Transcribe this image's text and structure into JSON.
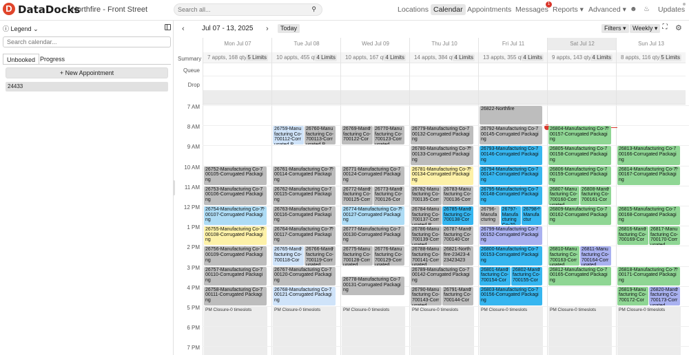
{
  "app": {
    "brand": "DataDocks",
    "logo_letter": "D",
    "location": "Northfire - Front Street"
  },
  "search": {
    "placeholder": "Search all..."
  },
  "nav": {
    "items": [
      "Locations",
      "Calendar",
      "Appointments",
      "Messages",
      "Reports ▾",
      "Advanced ▾"
    ],
    "active": "Calendar",
    "messages_badge": "1",
    "updates": "Updates"
  },
  "sidebar": {
    "legend": "Legend",
    "search_placeholder": "Search calendar...",
    "tabs": [
      "Unbooked",
      "Progress"
    ],
    "new_button": "+ New Appointment",
    "unbooked_items": [
      "24433"
    ]
  },
  "calendar": {
    "range": "Jul 07 - 13, 2025",
    "today_button": "Today",
    "filters": "Filters ▾",
    "view": "Weekly ▾",
    "gutter_labels": {
      "summary": "Summary",
      "queue": "Queue",
      "drop": "Drop"
    },
    "hours": [
      "7 AM",
      "8 AM",
      "9 AM",
      "10 AM",
      "11 AM",
      "12 PM",
      "1 PM",
      "2 PM",
      "3 PM",
      "4 PM",
      "5 PM",
      "6 PM",
      "7 PM"
    ],
    "closure_label": "PM Closure-0 timeslots",
    "limits_label": "Limits",
    "days": [
      {
        "label": "Mon Jul 07",
        "summary": "7 appts, 168 qty",
        "limits": "5"
      },
      {
        "label": "Tue Jul 08",
        "summary": "10 appts, 455 qty",
        "limits": "4"
      },
      {
        "label": "Wed Jul 09",
        "summary": "10 appts, 167 qty",
        "limits": "4"
      },
      {
        "label": "Thu Jul 10",
        "summary": "14 appts, 384 qty",
        "limits": "4"
      },
      {
        "label": "Fri Jul 11",
        "summary": "13 appts, 355 qty",
        "limits": "4"
      },
      {
        "label": "Sat Jul 12",
        "summary": "9 appts, 143 qty",
        "limits": "4",
        "today": true
      },
      {
        "label": "Sun Jul 13",
        "summary": "8 appts, 116 qty",
        "limits": "5"
      }
    ],
    "colors": {
      "gray": "#bdbdbd",
      "green": "#8fd694",
      "yellow": "#fdf1a8",
      "blue": "#aedcf5",
      "cyan": "#36b6f0",
      "purple": "#a9b1f0",
      "lightblue": "#cfe3f9"
    },
    "appointments": [
      {
        "day": 0,
        "start": "10:00",
        "end": "11:00",
        "lane": 0,
        "lanes": 1,
        "color": "gray",
        "text": "26752-Manufacturing Co-700105-Corrugated Packaging"
      },
      {
        "day": 0,
        "start": "11:00",
        "end": "12:00",
        "lane": 0,
        "lanes": 1,
        "color": "gray",
        "text": "26753-Manufacturing Co-700106-Corrugated Packaging"
      },
      {
        "day": 0,
        "start": "12:00",
        "end": "13:00",
        "lane": 0,
        "lanes": 1,
        "color": "blue",
        "text": "26754-Manufacturing Co-700107-Corrugated Packaging",
        "arrow": true
      },
      {
        "day": 0,
        "start": "13:00",
        "end": "14:00",
        "lane": 0,
        "lanes": 1,
        "color": "yellow",
        "text": "26755-Manufacturing Co-700108-Corrugated Packaging",
        "arrow": true
      },
      {
        "day": 0,
        "start": "14:00",
        "end": "15:00",
        "lane": 0,
        "lanes": 1,
        "color": "gray",
        "text": "26756-Manufacturing Co-700109-Corrugated Packaging"
      },
      {
        "day": 0,
        "start": "15:00",
        "end": "16:00",
        "lane": 0,
        "lanes": 1,
        "color": "gray",
        "text": "26757-Manufacturing Co-700110-Corrugated Packaging"
      },
      {
        "day": 0,
        "start": "16:00",
        "end": "17:00",
        "lane": 0,
        "lanes": 1,
        "color": "gray",
        "text": "26758-Manufacturing Co-700111-Corrugated Packaging"
      },
      {
        "day": 1,
        "start": "08:00",
        "end": "09:00",
        "lane": 0,
        "lanes": 2,
        "color": "lightblue",
        "text": "26759-Manufacturing Co-700112-Corrugated P"
      },
      {
        "day": 1,
        "start": "08:00",
        "end": "09:00",
        "lane": 1,
        "lanes": 2,
        "color": "gray",
        "text": "26760-Manufacturing Co-700113-Corrugated P"
      },
      {
        "day": 1,
        "start": "10:00",
        "end": "11:00",
        "lane": 0,
        "lanes": 1,
        "color": "gray",
        "text": "26761-Manufacturing Co-700114-Corrugated Packaging",
        "arrow": true
      },
      {
        "day": 1,
        "start": "11:00",
        "end": "12:00",
        "lane": 0,
        "lanes": 1,
        "color": "gray",
        "text": "26762-Manufacturing Co-700115-Corrugated Packaging"
      },
      {
        "day": 1,
        "start": "12:00",
        "end": "13:00",
        "lane": 0,
        "lanes": 1,
        "color": "gray",
        "text": "26763-Manufacturing Co-700116-Corrugated Packaging"
      },
      {
        "day": 1,
        "start": "13:00",
        "end": "14:00",
        "lane": 0,
        "lanes": 1,
        "color": "gray",
        "text": "26764-Manufacturing Co-700117-Corrugated Packaging",
        "arrow": true
      },
      {
        "day": 1,
        "start": "14:00",
        "end": "15:00",
        "lane": 0,
        "lanes": 2,
        "color": "lightblue",
        "text": "26765-Manufacturing Co-700118-Cor",
        "arrow": true
      },
      {
        "day": 1,
        "start": "14:00",
        "end": "15:00",
        "lane": 1,
        "lanes": 2,
        "color": "gray",
        "text": "26766-Manufacturing Co-700119-Corrugated",
        "arrow": true
      },
      {
        "day": 1,
        "start": "15:00",
        "end": "16:00",
        "lane": 0,
        "lanes": 1,
        "color": "gray",
        "text": "26767-Manufacturing Co-700120-Corrugated Packaging"
      },
      {
        "day": 1,
        "start": "16:00",
        "end": "17:00",
        "lane": 0,
        "lanes": 1,
        "color": "lightblue",
        "text": "26768-Manufacturing Co-700121-Corrugated Packaging"
      },
      {
        "day": 2,
        "start": "08:00",
        "end": "09:00",
        "lane": 0,
        "lanes": 2,
        "color": "gray",
        "text": "26769-Manufacturing Co-700122-Cor",
        "arrow": true
      },
      {
        "day": 2,
        "start": "08:00",
        "end": "09:00",
        "lane": 1,
        "lanes": 2,
        "color": "gray",
        "text": "26770-Manufacturing Co-700123-Corrugated"
      },
      {
        "day": 2,
        "start": "10:00",
        "end": "11:00",
        "lane": 0,
        "lanes": 1,
        "color": "gray",
        "text": "26771-Manufacturing Co-700124-Corrugated Packaging"
      },
      {
        "day": 2,
        "start": "11:00",
        "end": "12:00",
        "lane": 0,
        "lanes": 2,
        "color": "gray",
        "text": "26772-Manufacturing Co-700125-Corr",
        "arrow": true
      },
      {
        "day": 2,
        "start": "11:00",
        "end": "12:00",
        "lane": 1,
        "lanes": 2,
        "color": "gray",
        "text": "26773-Manufacturing Co-700126-Cor",
        "arrow": true
      },
      {
        "day": 2,
        "start": "12:00",
        "end": "13:00",
        "lane": 0,
        "lanes": 1,
        "color": "blue",
        "text": "26774-Manufacturing Co-700127-Corrugated Packaging",
        "arrow": true
      },
      {
        "day": 2,
        "start": "13:00",
        "end": "14:00",
        "lane": 0,
        "lanes": 1,
        "color": "gray",
        "text": "26777-Manufacturing Co-700130-Corrugated Packaging"
      },
      {
        "day": 2,
        "start": "14:00",
        "end": "15:00",
        "lane": 0,
        "lanes": 2,
        "color": "gray",
        "text": "26775-Manufacturing Co-700128-Corrugated"
      },
      {
        "day": 2,
        "start": "14:00",
        "end": "15:00",
        "lane": 1,
        "lanes": 2,
        "color": "gray",
        "text": "26776-Manufacturing Co-700129-Corrugated"
      },
      {
        "day": 2,
        "start": "15:30",
        "end": "16:30",
        "lane": 0,
        "lanes": 1,
        "color": "gray",
        "text": "26778-Manufacturing Co-700131-Corrugated Packaging"
      },
      {
        "day": 3,
        "start": "08:00",
        "end": "09:00",
        "lane": 0,
        "lanes": 1,
        "color": "gray",
        "text": "26779-Manufacturing Co-700132-Corrugated Packaging"
      },
      {
        "day": 3,
        "start": "09:00",
        "end": "10:00",
        "lane": 0,
        "lanes": 1,
        "color": "gray",
        "text": "26780-Manufacturing Co-700133-Corrugated Packaging",
        "arrow": true
      },
      {
        "day": 3,
        "start": "10:00",
        "end": "11:00",
        "lane": 0,
        "lanes": 1,
        "color": "yellow",
        "text": "26781-Manufacturing Co-700134-Corrugated Packaging",
        "arrow": true
      },
      {
        "day": 3,
        "start": "11:00",
        "end": "12:00",
        "lane": 0,
        "lanes": 2,
        "color": "gray",
        "text": "26782-Manufacturing Co-700135-Corr"
      },
      {
        "day": 3,
        "start": "11:00",
        "end": "12:00",
        "lane": 1,
        "lanes": 2,
        "color": "gray",
        "text": "26783-Manufacturing Co-700136-Corr"
      },
      {
        "day": 3,
        "start": "12:00",
        "end": "13:00",
        "lane": 0,
        "lanes": 2,
        "color": "gray",
        "text": "26784-Manufacturing Co-700137-Corrugated P"
      },
      {
        "day": 3,
        "start": "12:00",
        "end": "13:00",
        "lane": 1,
        "lanes": 2,
        "color": "cyan",
        "text": "26785-Manufacturing Co-700138-Cor",
        "arrow": true
      },
      {
        "day": 3,
        "start": "13:00",
        "end": "14:00",
        "lane": 0,
        "lanes": 2,
        "color": "gray",
        "text": "26786-Manufacturing Co-700139-Corrugated"
      },
      {
        "day": 3,
        "start": "13:00",
        "end": "14:00",
        "lane": 1,
        "lanes": 2,
        "color": "gray",
        "text": "26787-Manufacturing Co-700140-Cor",
        "arrow": true
      },
      {
        "day": 3,
        "start": "14:00",
        "end": "15:00",
        "lane": 0,
        "lanes": 2,
        "color": "gray",
        "text": "26788-Manufacturing Co-700141-Corrugated"
      },
      {
        "day": 3,
        "start": "14:00",
        "end": "15:00",
        "lane": 1,
        "lanes": 2,
        "color": "gray",
        "text": "26821-Northfire-23423-423423423",
        "sub": "Purchase"
      },
      {
        "day": 3,
        "start": "15:00",
        "end": "16:00",
        "lane": 0,
        "lanes": 1,
        "color": "gray",
        "text": "26789-Manufacturing Co-700142-Corrugated Packaging"
      },
      {
        "day": 3,
        "start": "16:00",
        "end": "17:00",
        "lane": 0,
        "lanes": 2,
        "color": "gray",
        "text": "26790-Manufacturing Co-700143-Corrugated"
      },
      {
        "day": 3,
        "start": "16:00",
        "end": "17:00",
        "lane": 1,
        "lanes": 2,
        "color": "gray",
        "text": "26791-Manufacturing Co-700144-Cor",
        "arrow": true
      },
      {
        "day": 4,
        "start": "07:00",
        "end": "08:00",
        "lane": 0,
        "lanes": 1,
        "color": "gray",
        "text": "26822-Northfire"
      },
      {
        "day": 4,
        "start": "08:00",
        "end": "09:00",
        "lane": 0,
        "lanes": 1,
        "color": "gray",
        "text": "26792-Manufacturing Co-700145-Corrugated Packaging"
      },
      {
        "day": 4,
        "start": "09:00",
        "end": "10:00",
        "lane": 0,
        "lanes": 1,
        "color": "cyan",
        "text": "26793-Manufacturing Co-700146-Corrugated Packaging"
      },
      {
        "day": 4,
        "start": "10:00",
        "end": "11:00",
        "lane": 0,
        "lanes": 1,
        "color": "cyan",
        "text": "26794-Manufacturing Co-700147-Corrugated Packaging"
      },
      {
        "day": 4,
        "start": "11:00",
        "end": "12:00",
        "lane": 0,
        "lanes": 1,
        "color": "cyan",
        "text": "26795-Manufacturing Co-700148-Corrugated Packaging"
      },
      {
        "day": 4,
        "start": "12:00",
        "end": "13:00",
        "lane": 0,
        "lanes": 3,
        "color": "gray",
        "text": "26796-Manufacturing"
      },
      {
        "day": 4,
        "start": "12:00",
        "end": "13:00",
        "lane": 1,
        "lanes": 3,
        "color": "cyan",
        "text": "26797-Manufacturing Co-70"
      },
      {
        "day": 4,
        "start": "12:00",
        "end": "13:00",
        "lane": 2,
        "lanes": 3,
        "color": "cyan",
        "text": "26798-Manufactur",
        "arrow": true
      },
      {
        "day": 4,
        "start": "13:00",
        "end": "14:00",
        "lane": 0,
        "lanes": 1,
        "color": "purple",
        "text": "26799-Manufacturing Co-700152-Corrugated Packaging"
      },
      {
        "day": 4,
        "start": "14:00",
        "end": "15:00",
        "lane": 0,
        "lanes": 1,
        "color": "cyan",
        "text": "26800-Manufacturing Co-700153-Corrugated Packaging"
      },
      {
        "day": 4,
        "start": "15:00",
        "end": "16:00",
        "lane": 0,
        "lanes": 2,
        "color": "cyan",
        "text": "26801-Manufacturing Co-700154-Cor",
        "arrow": true
      },
      {
        "day": 4,
        "start": "15:00",
        "end": "16:00",
        "lane": 1,
        "lanes": 2,
        "color": "cyan",
        "text": "26802-Manufacturing Co-700155-Cor",
        "arrow": true
      },
      {
        "day": 4,
        "start": "16:00",
        "end": "17:00",
        "lane": 0,
        "lanes": 1,
        "color": "cyan",
        "text": "26803-Manufacturing Co-700156-Corrugated Packaging"
      },
      {
        "day": 5,
        "start": "08:00",
        "end": "09:00",
        "lane": 0,
        "lanes": 1,
        "color": "green",
        "text": "26804-Manufacturing Co-700157-Corrugated Packaging",
        "arrow": true
      },
      {
        "day": 5,
        "start": "09:00",
        "end": "10:00",
        "lane": 0,
        "lanes": 1,
        "color": "green",
        "text": "26805-Manufacturing Co-700158-Corrugated Packaging"
      },
      {
        "day": 5,
        "start": "10:00",
        "end": "11:00",
        "lane": 0,
        "lanes": 1,
        "color": "green",
        "text": "26806-Manufacturing Co-700159-Corrugated Packaging"
      },
      {
        "day": 5,
        "start": "11:00",
        "end": "12:00",
        "lane": 0,
        "lanes": 2,
        "color": "green",
        "text": "26807-Manufacturing Co-700160-Corrugated"
      },
      {
        "day": 5,
        "start": "11:00",
        "end": "12:00",
        "lane": 1,
        "lanes": 2,
        "color": "green",
        "text": "26808-Manufacturing Co-700161-Cor",
        "arrow": true
      },
      {
        "day": 5,
        "start": "12:00",
        "end": "13:00",
        "lane": 0,
        "lanes": 1,
        "color": "green",
        "text": "26809-Manufacturing Co-700162-Corrugated Packaging"
      },
      {
        "day": 5,
        "start": "14:00",
        "end": "15:00",
        "lane": 0,
        "lanes": 2,
        "color": "green",
        "text": "26810-Manufacturing Co-700163-Corrugated"
      },
      {
        "day": 5,
        "start": "14:00",
        "end": "15:00",
        "lane": 1,
        "lanes": 2,
        "color": "purple",
        "text": "26811-Manufacturing Co-700164-Corrugated"
      },
      {
        "day": 5,
        "start": "15:00",
        "end": "16:00",
        "lane": 0,
        "lanes": 1,
        "color": "green",
        "text": "26812-Manufacturing Co-700165-Corrugated Packaging"
      },
      {
        "day": 6,
        "start": "09:00",
        "end": "10:00",
        "lane": 0,
        "lanes": 1,
        "color": "green",
        "text": "26813-Manufacturing Co-700166-Corrugated Packaging"
      },
      {
        "day": 6,
        "start": "10:00",
        "end": "11:00",
        "lane": 0,
        "lanes": 1,
        "color": "green",
        "text": "26814-Manufacturing Co-700167-Corrugated Packaging",
        "arrow": true
      },
      {
        "day": 6,
        "start": "12:00",
        "end": "13:00",
        "lane": 0,
        "lanes": 1,
        "color": "green",
        "text": "26815-Manufacturing Co-700168-Corrugated Packaging"
      },
      {
        "day": 6,
        "start": "13:00",
        "end": "14:00",
        "lane": 0,
        "lanes": 2,
        "color": "green",
        "text": "26816-Manufacturing Co-700169-Cor",
        "arrow": true
      },
      {
        "day": 6,
        "start": "13:00",
        "end": "14:00",
        "lane": 1,
        "lanes": 2,
        "color": "green",
        "text": "26817-Manufacturing Co-700170-Corrugated"
      },
      {
        "day": 6,
        "start": "15:00",
        "end": "16:00",
        "lane": 0,
        "lanes": 1,
        "color": "green",
        "text": "26818-Manufacturing Co-700171-Corrugated Packaging",
        "arrow": true
      },
      {
        "day": 6,
        "start": "16:00",
        "end": "17:00",
        "lane": 0,
        "lanes": 2,
        "color": "green",
        "text": "26819-Manufacturing Co-700172-Cor"
      },
      {
        "day": 6,
        "start": "16:00",
        "end": "17:00",
        "lane": 1,
        "lanes": 2,
        "color": "purple",
        "text": "26820-Manufacturing Co-700173-Corrugated",
        "arrow": true
      }
    ]
  }
}
